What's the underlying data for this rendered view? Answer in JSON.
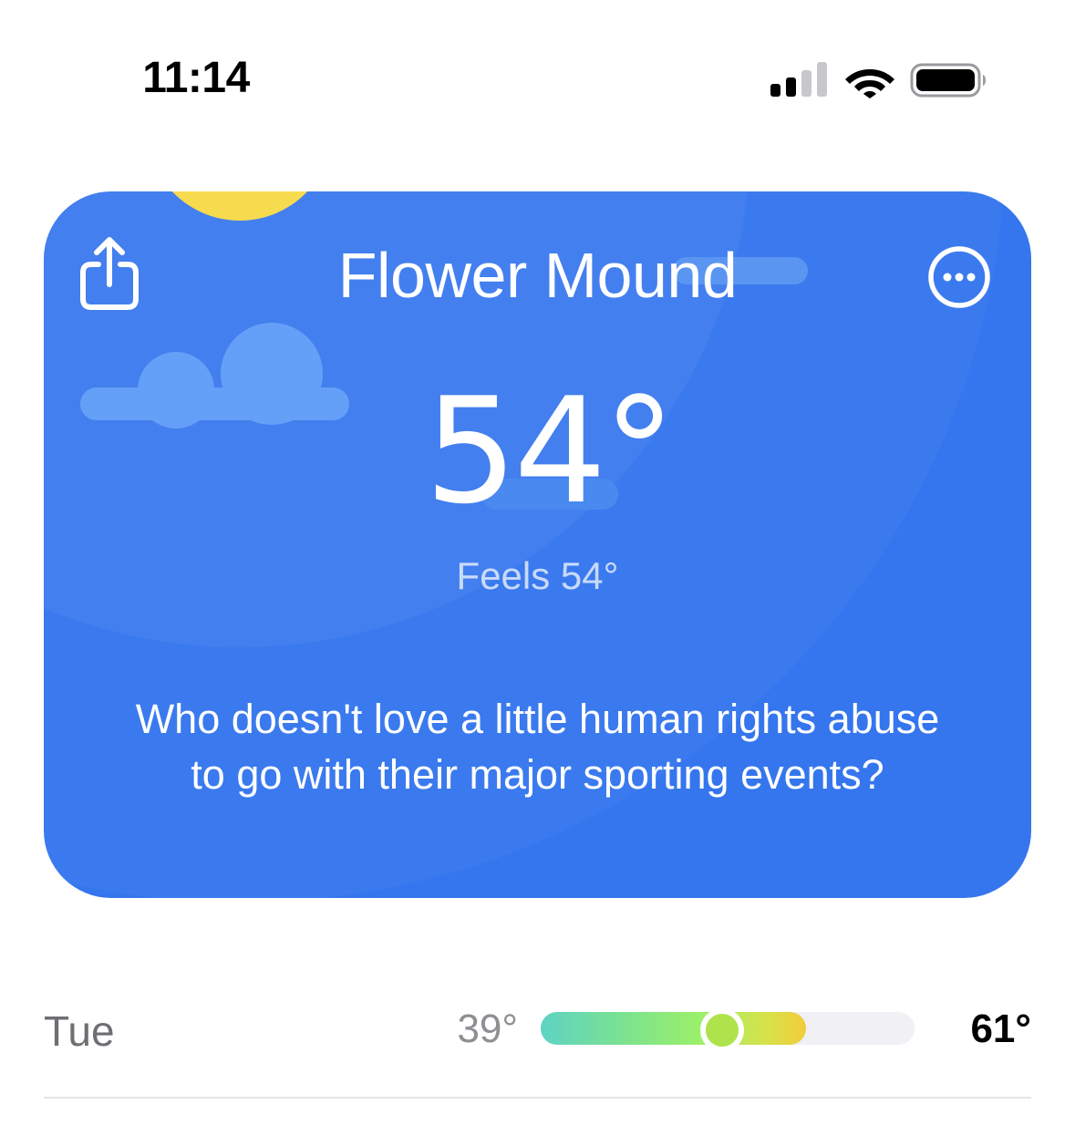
{
  "status_bar": {
    "time": "11:14",
    "signal_icon": "cellular-signal-icon",
    "wifi_icon": "wifi-icon",
    "battery_icon": "battery-icon"
  },
  "weather_card": {
    "city": "Flower Mound",
    "temperature": "54°",
    "feels_like": "Feels 54°",
    "message": "Who doesn't love a little human rights abuse to go with their major sporting events?",
    "share_icon": "share-icon",
    "more_icon": "more-options-icon",
    "background_color": "#3576ee",
    "sun_color": "#f7db4f"
  },
  "forecast": [
    {
      "day": "Tue",
      "low": "39°",
      "high": "61°",
      "range_fill_fraction": 0.71,
      "current_position_fraction": 0.48
    }
  ]
}
